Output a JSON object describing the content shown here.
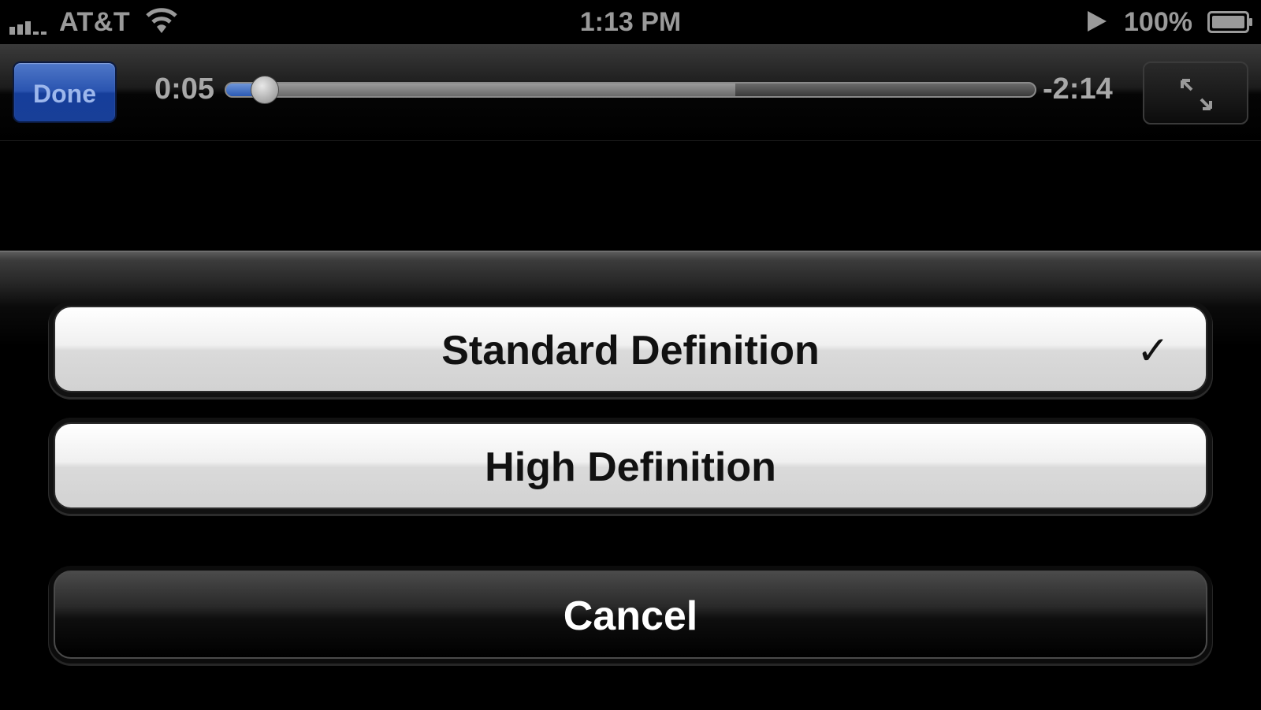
{
  "status_bar": {
    "carrier": "AT&T",
    "time": "1:13 PM",
    "battery_percent": "100%",
    "icons": [
      "signal-bars-icon",
      "wifi-icon",
      "play-icon",
      "battery-icon"
    ]
  },
  "player": {
    "done_label": "Done",
    "elapsed": "0:05",
    "remaining": "-2:14",
    "playback_progress": 0.04,
    "buffered_progress": 0.63,
    "fullscreen_icon": "exit-fullscreen-icon",
    "colors": {
      "done_button": "#2a54b0",
      "progress_fill": "#2b5ab4"
    }
  },
  "quality_sheet": {
    "options": [
      {
        "label": "Standard Definition",
        "selected": true,
        "check": "✓"
      },
      {
        "label": "High Definition",
        "selected": false,
        "check": ""
      }
    ],
    "cancel_label": "Cancel"
  }
}
